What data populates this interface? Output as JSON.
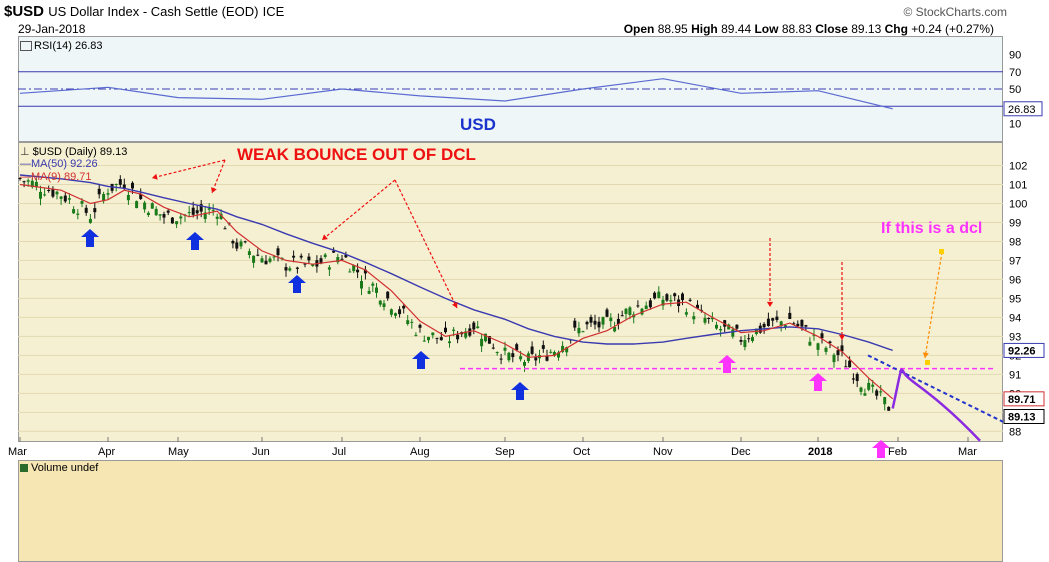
{
  "header": {
    "symbol": "$USD",
    "description": "US Dollar Index - Cash Settle (EOD)",
    "exchange": "ICE",
    "date": "29-Jan-2018",
    "brand": "© StockCharts.com",
    "open_label": "Open",
    "open": "88.95",
    "high_label": "High",
    "high": "89.44",
    "low_label": "Low",
    "low": "88.83",
    "close_label": "Close",
    "close": "89.13",
    "chg_label": "Chg",
    "chg": "+0.24 (+0.27%)"
  },
  "rsi": {
    "legend": "RSI(14) 26.83",
    "value_tag": "26.83",
    "watermark": "USD",
    "ticks": [
      90,
      70,
      50,
      30,
      10
    ],
    "upper": 70,
    "lower": 30
  },
  "price": {
    "legend_main": "$USD (Daily) 89.13",
    "legend_ma50": "MA(50) 92.26",
    "legend_ma9": "MA(9) 89.71",
    "tag_ma50": "92.26",
    "tag_ma9": "89.71",
    "tag_close": "89.13",
    "ticks": [
      102,
      101,
      100,
      99,
      98,
      97,
      96,
      95,
      94,
      93,
      92,
      91,
      90,
      89,
      88
    ]
  },
  "annotations": {
    "weak_bounce": "WEAK BOUNCE OUT OF DCL",
    "if_dcl": "If this is a dcl"
  },
  "x_labels": [
    "Mar",
    "Apr",
    "May",
    "Jun",
    "Jul",
    "Aug",
    "Sep",
    "Oct",
    "Nov",
    "Dec",
    "2018",
    "Feb",
    "Mar"
  ],
  "volume": {
    "legend": "Volume undef"
  },
  "colors": {
    "up": "#1a7a1a",
    "down": "#111111",
    "ma50": "#3a3ab0",
    "ma9": "#d03030",
    "annotation_red": "#ee1111",
    "blue_arrow": "#1030e0",
    "pink": "#ff33ff",
    "purple": "#8a2be2"
  },
  "chart_data": [
    {
      "type": "line",
      "title": "RSI(14) 26.83",
      "ylim": [
        0,
        100
      ],
      "reference_lines": [
        70,
        30
      ],
      "x": [
        "Mar",
        "Apr",
        "May",
        "Jun",
        "Jul",
        "Aug",
        "Sep",
        "Oct",
        "Nov",
        "Dec",
        "2018",
        "Jan-29"
      ],
      "series": [
        {
          "name": "RSI(14)",
          "values": [
            45,
            52,
            40,
            38,
            50,
            42,
            36,
            50,
            62,
            45,
            48,
            27
          ]
        }
      ]
    },
    {
      "type": "line",
      "title": "$USD (Daily) 89.13",
      "ylim": [
        87.7,
        102.5
      ],
      "x": [
        "Mar-01",
        "Mar-15",
        "Mar-25",
        "Apr-01",
        "Apr-08",
        "Apr-15",
        "Apr-25",
        "May-05",
        "May-15",
        "May-22",
        "Jun-01",
        "Jun-10",
        "Jun-20",
        "Jul-01",
        "Jul-10",
        "Jul-20",
        "Aug-01",
        "Aug-10",
        "Aug-20",
        "Sep-01",
        "Sep-10",
        "Sep-20",
        "Oct-01",
        "Oct-10",
        "Oct-20",
        "Nov-01",
        "Nov-10",
        "Nov-20",
        "Dec-01",
        "Dec-10",
        "Dec-20",
        "Jan-01",
        "Jan-10",
        "Jan-20",
        "Jan-29"
      ],
      "series": [
        {
          "name": "$USD",
          "values": [
            101.3,
            100.5,
            99.4,
            100.8,
            101.1,
            100.2,
            99.3,
            99.4,
            99.7,
            97.8,
            97.2,
            96.8,
            96.7,
            97.3,
            96.0,
            94.8,
            93.2,
            92.8,
            93.6,
            92.0,
            91.7,
            92.3,
            93.5,
            93.6,
            94.5,
            95.0,
            94.7,
            93.6,
            92.9,
            93.5,
            93.9,
            92.7,
            91.9,
            90.2,
            89.13
          ]
        },
        {
          "name": "MA(50)",
          "values": [
            101.5,
            101.3,
            101.1,
            100.9,
            100.8,
            100.6,
            100.3,
            100.0,
            99.7,
            99.3,
            98.9,
            98.4,
            97.9,
            97.4,
            96.9,
            96.3,
            95.6,
            95.0,
            94.4,
            93.9,
            93.4,
            93.0,
            92.7,
            92.6,
            92.6,
            92.7,
            92.9,
            93.1,
            93.3,
            93.4,
            93.5,
            93.4,
            93.1,
            92.7,
            92.26
          ]
        },
        {
          "name": "MA(9)",
          "values": [
            101.0,
            100.7,
            100.0,
            100.2,
            100.7,
            100.5,
            99.8,
            99.3,
            99.6,
            98.5,
            97.5,
            97.0,
            96.8,
            97.0,
            96.5,
            95.4,
            93.8,
            93.0,
            93.3,
            92.6,
            91.9,
            92.0,
            92.9,
            93.3,
            94.1,
            94.7,
            94.8,
            94.0,
            93.2,
            93.3,
            93.7,
            93.0,
            92.2,
            90.8,
            89.71
          ]
        }
      ],
      "reference_lines": [
        91.3
      ],
      "projections": [
        {
          "name": "MA(50) projection",
          "x": [
            "Feb-01",
            "Mar-01"
          ],
          "values": [
            92.0,
            88.5
          ]
        },
        {
          "name": "price projection",
          "x": [
            "Jan-29",
            "Feb-05",
            "Feb-20",
            "Mar-05"
          ],
          "values": [
            89.2,
            91.0,
            90.0,
            87.5
          ]
        }
      ]
    }
  ]
}
